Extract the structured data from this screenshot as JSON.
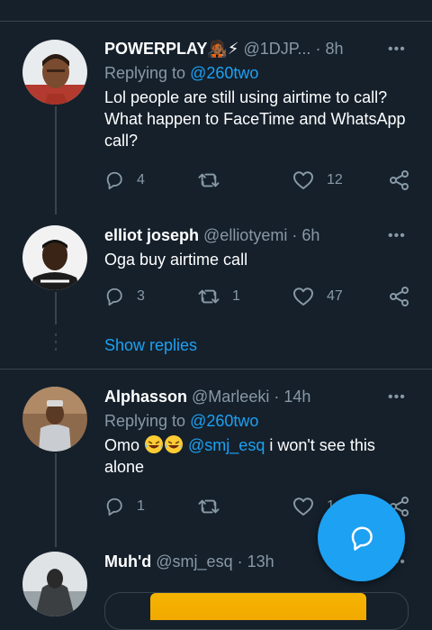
{
  "theme": {
    "background": "#15202b",
    "accent": "#1da1f2",
    "muted": "#8899a6",
    "divider": "#38444d"
  },
  "tweets": [
    {
      "name": "POWERPLAY",
      "name_emoji": "🧑🏾‍🎤⚡",
      "handle": "@1DJP...",
      "time": "8h",
      "replying_prefix": "Replying to ",
      "replying_to": "@260two",
      "text": "Lol people are still using airtime to call? What happen to FaceTime and WhatsApp call?",
      "replies": "4",
      "retweets": "",
      "likes": "12"
    },
    {
      "name": "elliot joseph",
      "handle": "@elliotyemi",
      "time": "6h",
      "text": "Oga buy airtime call",
      "replies": "3",
      "retweets": "1",
      "likes": "47"
    },
    {
      "name": "Alphasson",
      "handle": "@Marleeki",
      "time": "14h",
      "replying_prefix": "Replying to ",
      "replying_to": "@260two",
      "text_prefix": "Omo ",
      "mention": "@smj_esq",
      "text_suffix": " i won't see this alone",
      "replies": "1",
      "retweets": "",
      "likes": "1"
    },
    {
      "name": "Muh'd",
      "handle": "@smj_esq",
      "time": "13h"
    }
  ],
  "show_replies": "Show replies",
  "dot": "·",
  "more": "•••",
  "icons": {
    "reply": "reply-icon",
    "retweet": "retweet-icon",
    "like": "heart-icon",
    "share": "share-icon",
    "compose": "compose-reply-icon"
  }
}
